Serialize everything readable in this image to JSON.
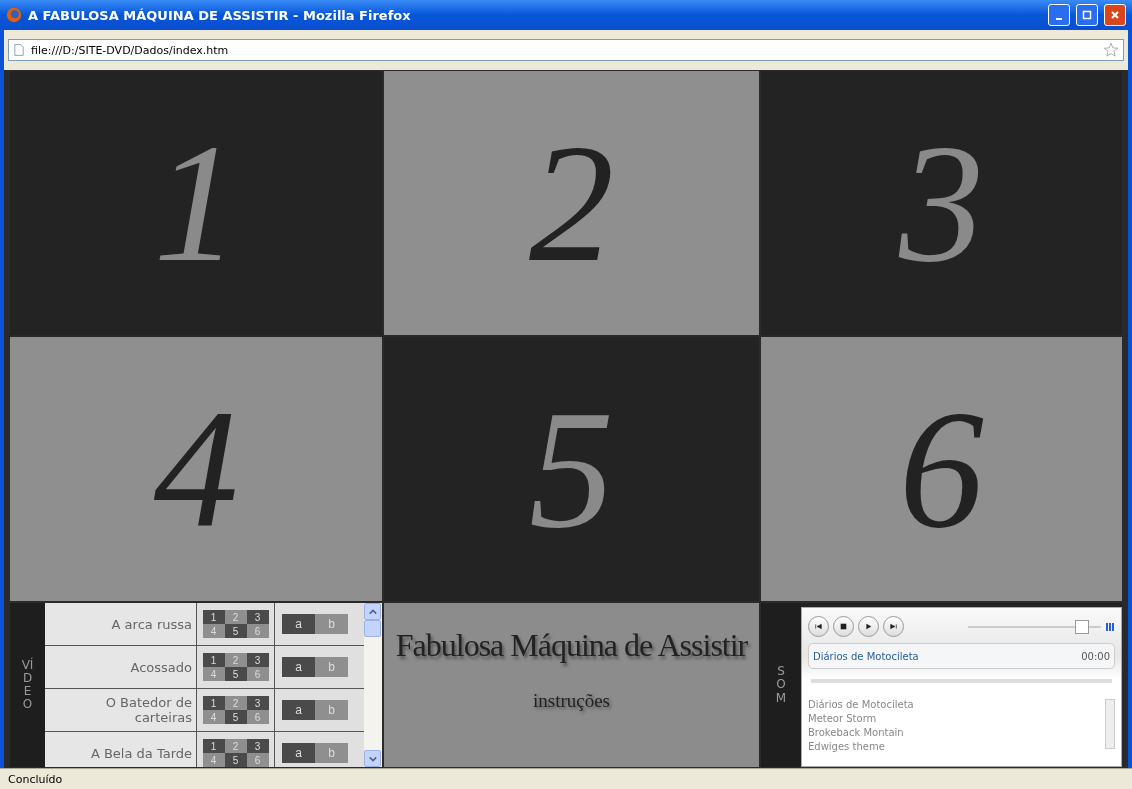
{
  "window": {
    "title": "A FABULOSA MÁQUINA DE ASSISTIR - Mozilla Firefox"
  },
  "address_bar": {
    "url": "file:///D:/SITE-DVD/Dados/index.htm"
  },
  "screens": [
    {
      "label": "1",
      "dark": true
    },
    {
      "label": "2",
      "dark": false
    },
    {
      "label": "3",
      "dark": true
    },
    {
      "label": "4",
      "dark": false
    },
    {
      "label": "5",
      "dark": true
    },
    {
      "label": "6",
      "dark": false
    }
  ],
  "video_panel": {
    "heading": "VÍDEO",
    "films": [
      {
        "title": "A arca russa",
        "screens": [
          {
            "label": "1",
            "dark": true
          },
          {
            "label": "2",
            "dark": false
          },
          {
            "label": "3",
            "dark": true
          },
          {
            "label": "4",
            "dark": false
          },
          {
            "label": "5",
            "dark": true
          },
          {
            "label": "6",
            "dark": false
          }
        ],
        "tracks": [
          {
            "label": "a",
            "dark": true
          },
          {
            "label": "b",
            "dark": false
          }
        ]
      },
      {
        "title": "Acossado",
        "screens": [
          {
            "label": "1",
            "dark": true
          },
          {
            "label": "2",
            "dark": false
          },
          {
            "label": "3",
            "dark": true
          },
          {
            "label": "4",
            "dark": false
          },
          {
            "label": "5",
            "dark": true
          },
          {
            "label": "6",
            "dark": false
          }
        ],
        "tracks": [
          {
            "label": "a",
            "dark": true
          },
          {
            "label": "b",
            "dark": false
          }
        ]
      },
      {
        "title": "O Batedor de carteiras",
        "screens": [
          {
            "label": "1",
            "dark": true
          },
          {
            "label": "2",
            "dark": false
          },
          {
            "label": "3",
            "dark": true
          },
          {
            "label": "4",
            "dark": false
          },
          {
            "label": "5",
            "dark": true
          },
          {
            "label": "6",
            "dark": false
          }
        ],
        "tracks": [
          {
            "label": "a",
            "dark": true
          },
          {
            "label": "b",
            "dark": false
          }
        ]
      },
      {
        "title": "A Bela da Tarde",
        "screens": [
          {
            "label": "1",
            "dark": true
          },
          {
            "label": "2",
            "dark": false
          },
          {
            "label": "3",
            "dark": true
          },
          {
            "label": "4",
            "dark": false
          },
          {
            "label": "5",
            "dark": true
          },
          {
            "label": "6",
            "dark": false
          }
        ],
        "tracks": [
          {
            "label": "a",
            "dark": true
          },
          {
            "label": "b",
            "dark": false
          }
        ]
      }
    ]
  },
  "center_panel": {
    "title": "Fabulosa Máquina de Assistir",
    "link": "instruções"
  },
  "sound_panel": {
    "heading": "SOM",
    "player": {
      "volume": {
        "level": 0.9
      },
      "now_playing": "Diários de Motocileta",
      "time": "00:00",
      "playlist": [
        "Diários de Motocileta",
        "Meteor Storm",
        "Brokeback Montain",
        "Edwiges theme"
      ]
    }
  },
  "status_bar": {
    "text": "Concluído"
  }
}
